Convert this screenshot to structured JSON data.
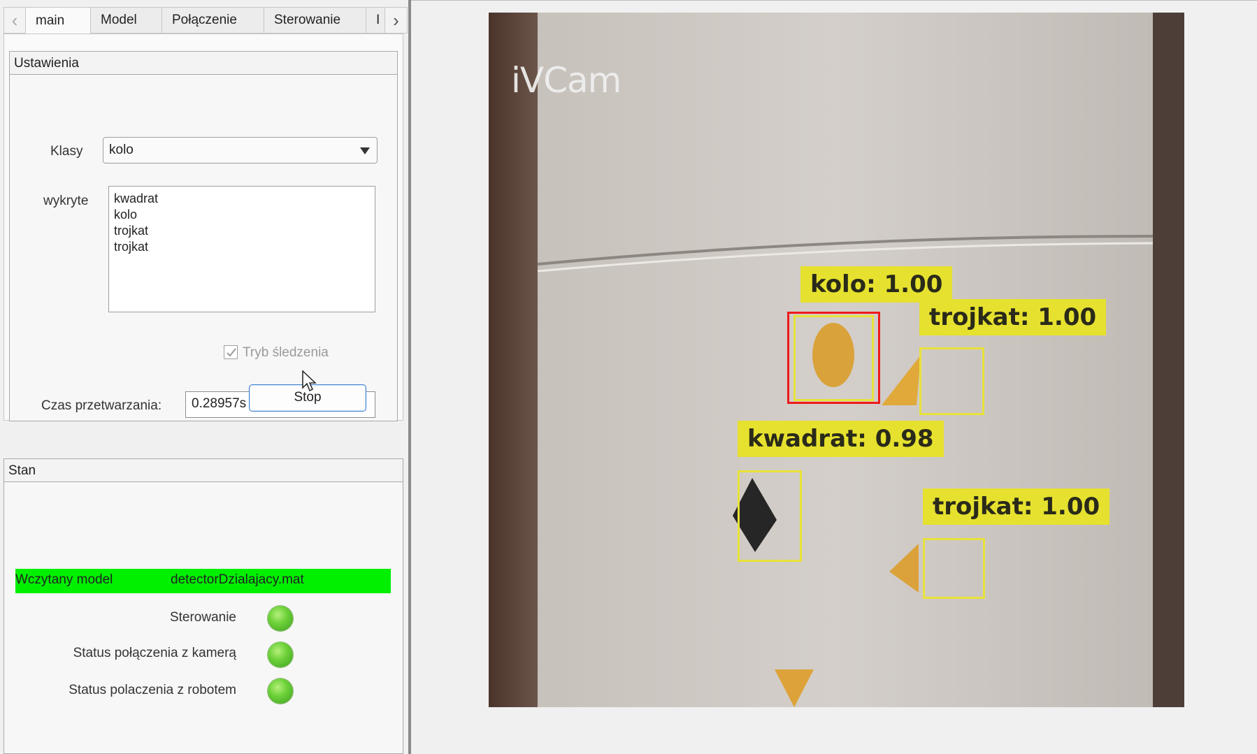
{
  "tabs": {
    "items": [
      {
        "label": "main",
        "active": true
      },
      {
        "label": "Model"
      },
      {
        "label": "Połączenie"
      },
      {
        "label": "Sterowanie"
      },
      {
        "label": "I"
      }
    ],
    "scroll_left_icon": "chevron-left-icon",
    "scroll_right_icon": "chevron-right-icon"
  },
  "settings": {
    "title": "Ustawienia",
    "klasy_label": "Klasy",
    "klasy_value": "kolo",
    "wykryte_label": "wykryte",
    "wykryte_items": [
      "kwadrat",
      "kolo",
      "trojkat",
      "trojkat"
    ],
    "tracking_label": "Tryb śledzenia",
    "tracking_checked": true,
    "czas_label": "Czas przetwarzania:",
    "czas_value": "0.28957s",
    "stop_label": "Stop"
  },
  "status": {
    "title": "Stan",
    "model_label": "Wczytany model",
    "model_value": "detectorDzialajacy.mat",
    "rows": [
      {
        "label": "Sterowanie",
        "status": "green"
      },
      {
        "label": "Status połączenia z kamerą",
        "status": "green"
      },
      {
        "label": "Status polaczenia z robotem",
        "status": "green"
      }
    ]
  },
  "camera": {
    "watermark": "iVCam",
    "detections": [
      {
        "label": "kolo:  1.00",
        "selected": true
      },
      {
        "label": "trojkat:  1.00"
      },
      {
        "label": "kwadrat:  0.98"
      },
      {
        "label": "trojkat:  1.00"
      }
    ]
  },
  "colors": {
    "detection_box": "#e8e23a",
    "selected_box": "#ee1a1a",
    "model_banner": "#00f000",
    "led_ok": "#5cc22e"
  }
}
